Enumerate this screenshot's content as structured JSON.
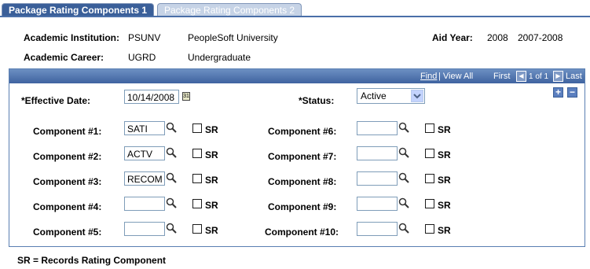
{
  "tabs": [
    {
      "label": "Package Rating Components 1",
      "active": true
    },
    {
      "label": "Package Rating Components 2",
      "active": false
    }
  ],
  "header": {
    "institution_label": "Academic Institution:",
    "institution_code": "PSUNV",
    "institution_name": "PeopleSoft University",
    "aid_year_label": "Aid Year:",
    "aid_year": "2008",
    "aid_year_desc": "2007-2008",
    "career_label": "Academic Career:",
    "career_code": "UGRD",
    "career_name": "Undergraduate"
  },
  "grid_nav": {
    "find": "Find",
    "view_all": "| View All",
    "first": "First",
    "range": "1 of 1",
    "last": "Last"
  },
  "form": {
    "effective_date_label": "*Effective Date:",
    "effective_date": "10/14/2008",
    "status_label": "*Status:",
    "status_value": "Active",
    "sr_label": "SR",
    "components_left": [
      {
        "label": "Component #1:",
        "value": "SATI"
      },
      {
        "label": "Component #2:",
        "value": "ACTV"
      },
      {
        "label": "Component #3:",
        "value": "RECOM"
      },
      {
        "label": "Component #4:",
        "value": ""
      },
      {
        "label": "Component #5:",
        "value": ""
      }
    ],
    "components_right": [
      {
        "label": "Component #6:",
        "value": ""
      },
      {
        "label": "Component #7:",
        "value": ""
      },
      {
        "label": "Component #8:",
        "value": ""
      },
      {
        "label": "Component #9:",
        "value": ""
      },
      {
        "label": "Component #10:",
        "value": ""
      }
    ]
  },
  "footnote": "SR = Records Rating Component",
  "icons": {
    "lookup": "magnifier-icon",
    "calendar": "calendar-icon",
    "add": "plus-icon",
    "remove": "minus-icon"
  },
  "colors": {
    "tab_active": "#3a5f99",
    "tab_inactive": "#c6d3e6",
    "frame_header": "#4b6ea6"
  }
}
